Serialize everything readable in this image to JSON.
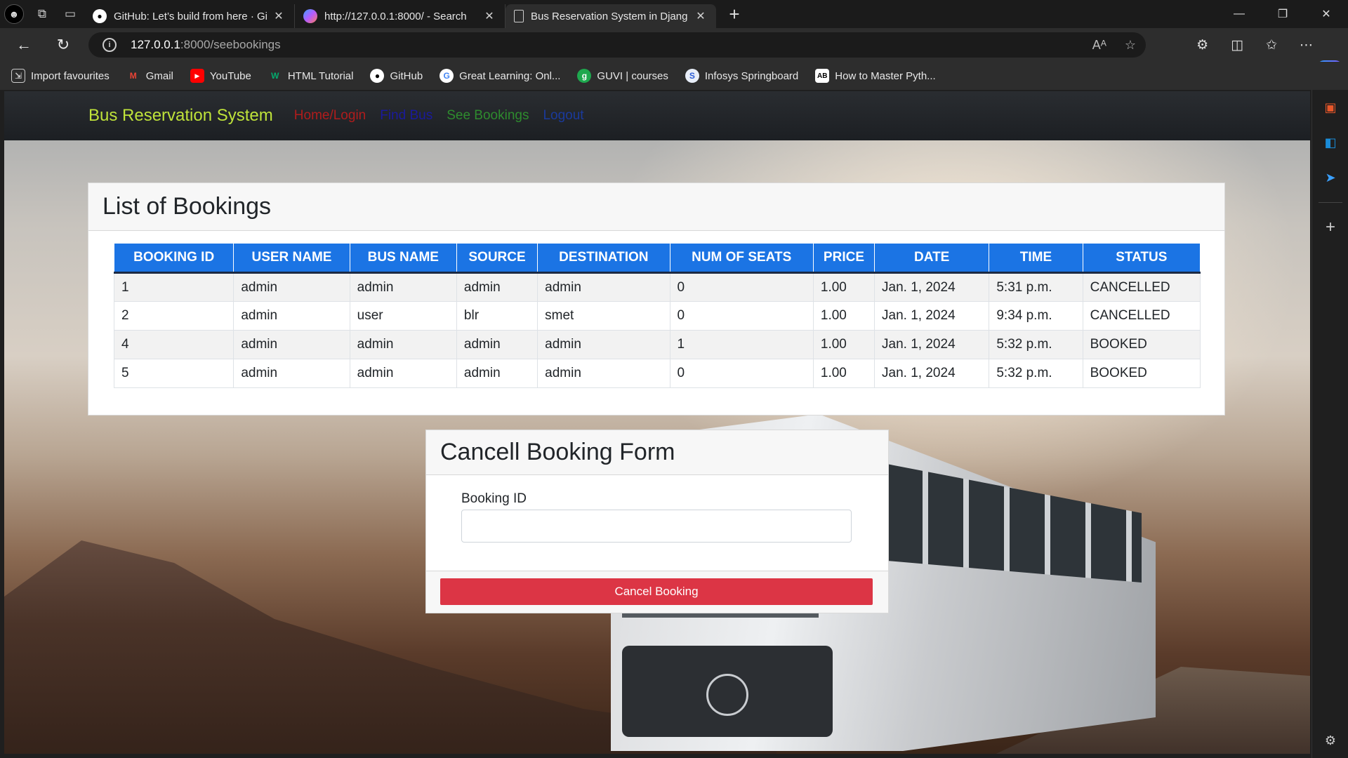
{
  "browser": {
    "tabs": [
      {
        "title": "GitHub: Let’s build from here · Gi",
        "icon": "github-icon",
        "active": false
      },
      {
        "title": "http://127.0.0.1:8000/ - Search",
        "icon": "copilot-search-icon",
        "active": false
      },
      {
        "title": "Bus Reservation System in Djang",
        "icon": "page-icon",
        "active": true
      }
    ],
    "url_host": "127.0.0.1",
    "url_path": ":8000/seebookings",
    "bookmarks": [
      {
        "label": "Import favourites",
        "icon": "import-icon"
      },
      {
        "label": "Gmail",
        "icon": "gmail-icon"
      },
      {
        "label": "YouTube",
        "icon": "youtube-icon"
      },
      {
        "label": "HTML Tutorial",
        "icon": "w3schools-icon"
      },
      {
        "label": "GitHub",
        "icon": "github-icon"
      },
      {
        "label": "Great Learning: Onl...",
        "icon": "google-icon"
      },
      {
        "label": "GUVI | courses",
        "icon": "guvi-icon"
      },
      {
        "label": "Infosys Springboard",
        "icon": "infosys-icon"
      },
      {
        "label": "How to Master Pyth...",
        "icon": "ab-icon"
      }
    ]
  },
  "site": {
    "brand": "Bus Reservation System",
    "nav": [
      {
        "label": "Home/Login",
        "color": "#b01c1c"
      },
      {
        "label": "Find Bus",
        "color": "#1a1a9c"
      },
      {
        "label": "See Bookings",
        "color": "#2e8b2e"
      },
      {
        "label": "Logout",
        "color": "#1a3a9c"
      }
    ],
    "brand_color": "#bfe33a"
  },
  "bookings": {
    "title": "List of Bookings",
    "columns": [
      "BOOKING ID",
      "USER NAME",
      "BUS NAME",
      "SOURCE",
      "DESTINATION",
      "NUM OF SEATS",
      "PRICE",
      "DATE",
      "TIME",
      "STATUS"
    ],
    "rows": [
      [
        "1",
        "admin",
        "admin",
        "admin",
        "admin",
        "0",
        "1.00",
        "Jan. 1, 2024",
        "5:31 p.m.",
        "CANCELLED"
      ],
      [
        "2",
        "admin",
        "user",
        "blr",
        "smet",
        "0",
        "1.00",
        "Jan. 1, 2024",
        "9:34 p.m.",
        "CANCELLED"
      ],
      [
        "4",
        "admin",
        "admin",
        "admin",
        "admin",
        "1",
        "1.00",
        "Jan. 1, 2024",
        "5:32 p.m.",
        "BOOKED"
      ],
      [
        "5",
        "admin",
        "admin",
        "admin",
        "admin",
        "0",
        "1.00",
        "Jan. 1, 2024",
        "5:32 p.m.",
        "BOOKED"
      ]
    ],
    "header_color": "#1b74e4"
  },
  "cancel_form": {
    "title": "Cancell Booking Form",
    "field_label": "Booking ID",
    "field_value": "",
    "button_label": "Cancel Booking",
    "button_color": "#dc3545"
  }
}
